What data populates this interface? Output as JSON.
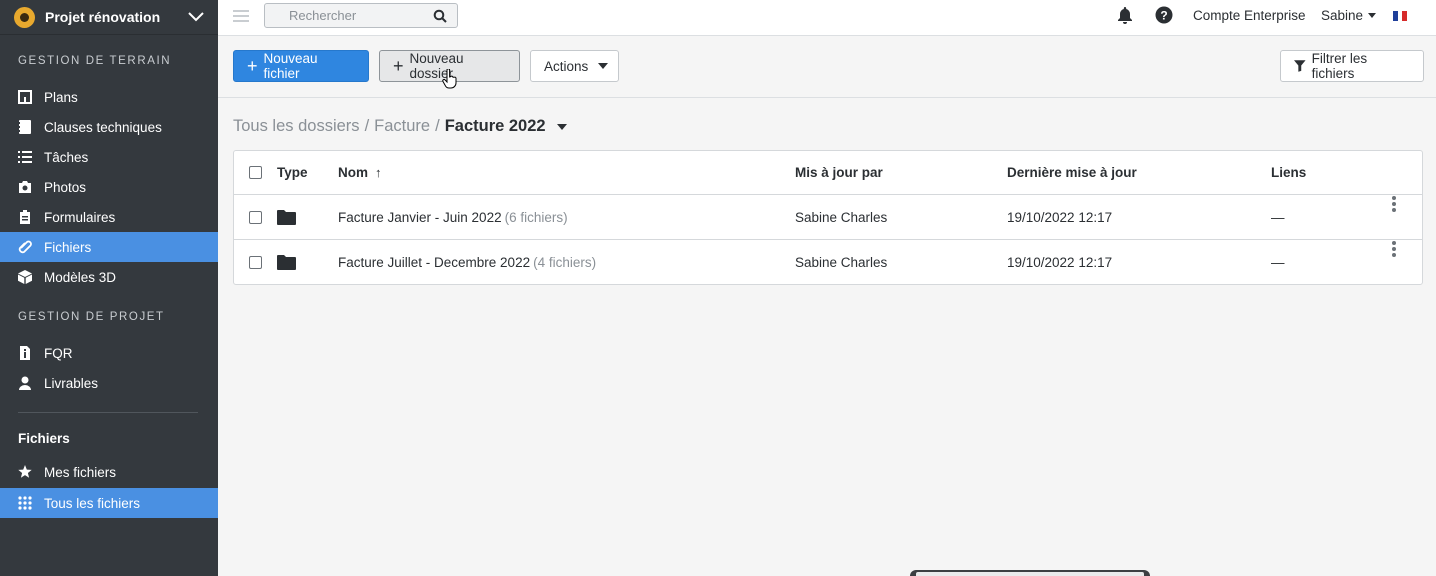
{
  "project": {
    "name": "Projet rénovation"
  },
  "sidebar": {
    "section_terrain": "GESTION DE TERRAIN",
    "terrain_items": [
      {
        "label": "Plans",
        "icon": "plans-icon"
      },
      {
        "label": "Clauses techniques",
        "icon": "book-icon"
      },
      {
        "label": "Tâches",
        "icon": "list-icon"
      },
      {
        "label": "Photos",
        "icon": "camera-icon"
      },
      {
        "label": "Formulaires",
        "icon": "clipboard-icon"
      },
      {
        "label": "Fichiers",
        "icon": "paperclip-icon",
        "active": true
      },
      {
        "label": "Modèles 3D",
        "icon": "cube-icon"
      }
    ],
    "section_projet": "GESTION DE PROJET",
    "projet_items": [
      {
        "label": "FQR",
        "icon": "file-info-icon"
      },
      {
        "label": "Livrables",
        "icon": "user-icon"
      }
    ],
    "files_section": "Fichiers",
    "files_items": [
      {
        "label": "Mes fichiers",
        "icon": "star-icon"
      },
      {
        "label": "Tous les fichiers",
        "icon": "grid-icon",
        "active": true
      }
    ]
  },
  "topbar": {
    "search_placeholder": "Rechercher",
    "account": "Compte Enterprise",
    "user": "Sabine"
  },
  "toolbar": {
    "new_file": "Nouveau fichier",
    "new_folder": "Nouveau dossier",
    "actions": "Actions",
    "filter": "Filtrer les fichiers"
  },
  "breadcrumb": {
    "root": "Tous les dossiers",
    "parent": "Facture",
    "current": "Facture 2022"
  },
  "table": {
    "headers": {
      "type": "Type",
      "name": "Nom",
      "updated_by": "Mis à jour par",
      "last_update": "Dernière mise à jour",
      "links": "Liens"
    },
    "rows": [
      {
        "name": "Facture Janvier - Juin 2022",
        "count": "(6 fichiers)",
        "updated_by": "Sabine Charles",
        "last_update": "19/10/2022 12:17",
        "links": "—"
      },
      {
        "name": "Facture Juillet - Decembre 2022",
        "count": "(4 fichiers)",
        "updated_by": "Sabine Charles",
        "last_update": "19/10/2022 12:17",
        "links": "—"
      }
    ]
  },
  "colors": {
    "accent": "#4a90e2",
    "primary_button": "#2f86e0",
    "sidebar": "#34393e"
  }
}
